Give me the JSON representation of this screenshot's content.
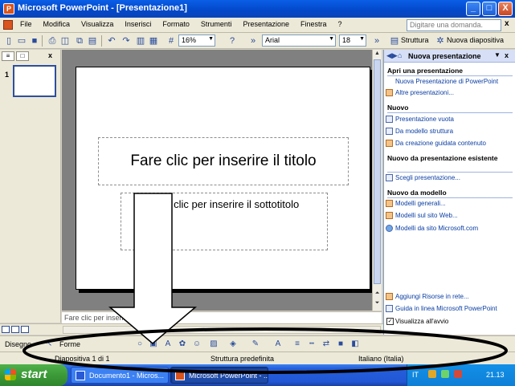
{
  "window": {
    "title": "Microsoft PowerPoint - [Presentazione1]",
    "app_icon": "P",
    "minimize": "_",
    "maximize": "□",
    "close": "X"
  },
  "menubar": {
    "items": [
      "File",
      "Modifica",
      "Visualizza",
      "Inserisci",
      "Formato",
      "Strumenti",
      "Presentazione",
      "Finestra",
      "?"
    ],
    "help_placeholder": "Digitare una domanda.",
    "doc_close": "x"
  },
  "toolbar": {
    "zoom": "16%",
    "font": "Arial",
    "font_size": "18",
    "struttura_label": "Struttura",
    "nuova_diapositiva_label": "Nuova diapositiva"
  },
  "left_pane": {
    "tabs": [
      "≡",
      "□"
    ],
    "close": "x",
    "slide_number": "1"
  },
  "slide": {
    "title_placeholder": "Fare clic per inserire il titolo",
    "subtitle_placeholder": "Fare clic per inserire il sottotitolo"
  },
  "notes": {
    "placeholder": "Fare clic per inserire le note"
  },
  "task_pane": {
    "title": "Nuova presentazione",
    "sections": [
      {
        "heading": "Apri una presentazione",
        "links": [
          "Nuova Presentazione di PowerPoint",
          "Altre presentazioni..."
        ]
      },
      {
        "heading": "Nuovo",
        "links": [
          "Presentazione vuota",
          "Da modello struttura",
          "Da creazione guidata contenuto"
        ]
      },
      {
        "heading": "Nuovo da presentazione esistente",
        "links": [
          "Scegli presentazione..."
        ]
      },
      {
        "heading": "Nuovo da modello",
        "links": [
          "Modelli generali...",
          "Modelli sul sito Web...",
          "Modelli da sito Microsoft.com"
        ]
      }
    ],
    "bottom_links": [
      "Aggiungi Risorse in rete...",
      "Guida in linea Microsoft PowerPoint"
    ],
    "show_at_startup": "Visualizza all'avvio"
  },
  "drawing_toolbar": {
    "disegno": "Disegno",
    "forme": "Forme"
  },
  "status_bar": {
    "slide": "Diapositiva 1 di 1",
    "design": "Struttura predefinita",
    "language": "Italiano (Italia)"
  },
  "taskbar": {
    "start": "start",
    "tasks": [
      "Documento1 - Micros...",
      "Microsoft PowerPoint - ..."
    ],
    "lang": "IT",
    "clock": "21.13"
  },
  "annotation": {
    "arrow_color": "#ffffff",
    "ellipse_color": "#000000"
  }
}
